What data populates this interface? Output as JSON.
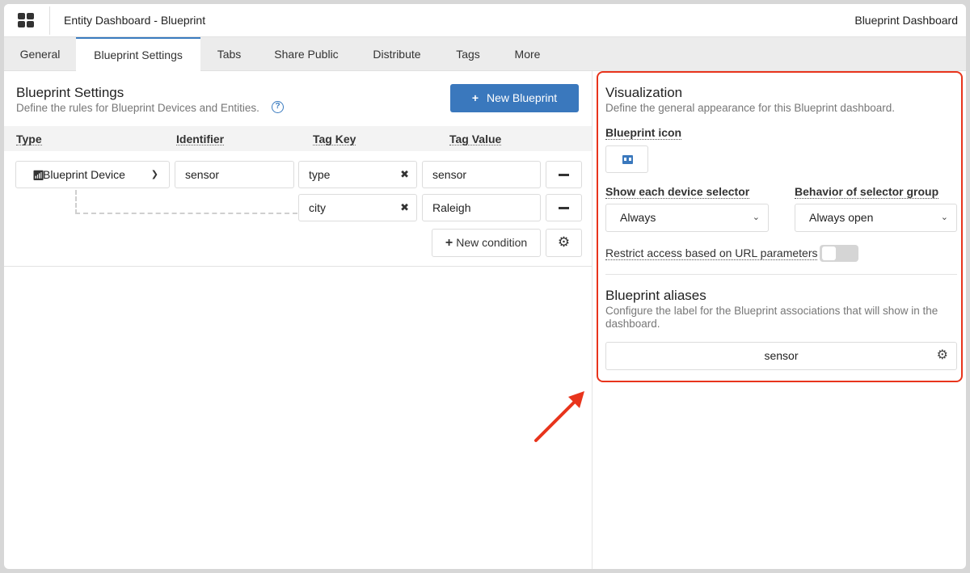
{
  "header": {
    "app_title": "Entity Dashboard - Blueprint",
    "right_label": "Blueprint Dashboard",
    "apps_icon": "grid-icon"
  },
  "tabs": [
    {
      "label": "General",
      "active": false
    },
    {
      "label": "Blueprint Settings",
      "active": true
    },
    {
      "label": "Tabs",
      "active": false
    },
    {
      "label": "Share Public",
      "active": false
    },
    {
      "label": "Distribute",
      "active": false
    },
    {
      "label": "Tags",
      "active": false
    },
    {
      "label": "More",
      "active": false
    }
  ],
  "blueprint_settings": {
    "title": "Blueprint Settings",
    "subtitle": "Define the rules for Blueprint Devices and Entities.",
    "help_glyph": "?",
    "new_button": "New Blueprint",
    "columns": [
      "Type",
      "Identifier",
      "Tag Key",
      "Tag Value"
    ],
    "type_value": "Blueprint Device",
    "identifier_value": "sensor",
    "conditions": [
      {
        "tag_key": "type",
        "tag_value": "sensor"
      },
      {
        "tag_key": "city",
        "tag_value": "Raleigh"
      }
    ],
    "new_condition_button": "New condition"
  },
  "visualization": {
    "title": "Visualization",
    "subtitle": "Define the general appearance for this Blueprint dashboard.",
    "icon_label": "Blueprint icon",
    "device_selector_label": "Show each device selector",
    "device_selector_value": "Always",
    "selector_group_label": "Behavior of selector group",
    "selector_group_value": "Always open",
    "restrict_label": "Restrict access based on URL parameters",
    "restrict_enabled": false
  },
  "aliases": {
    "title": "Blueprint aliases",
    "subtitle": "Configure the label for the Blueprint associations that will show in the dashboard.",
    "alias_value": "sensor"
  },
  "colors": {
    "accent": "#3a78bd",
    "highlight": "#e8341c"
  }
}
